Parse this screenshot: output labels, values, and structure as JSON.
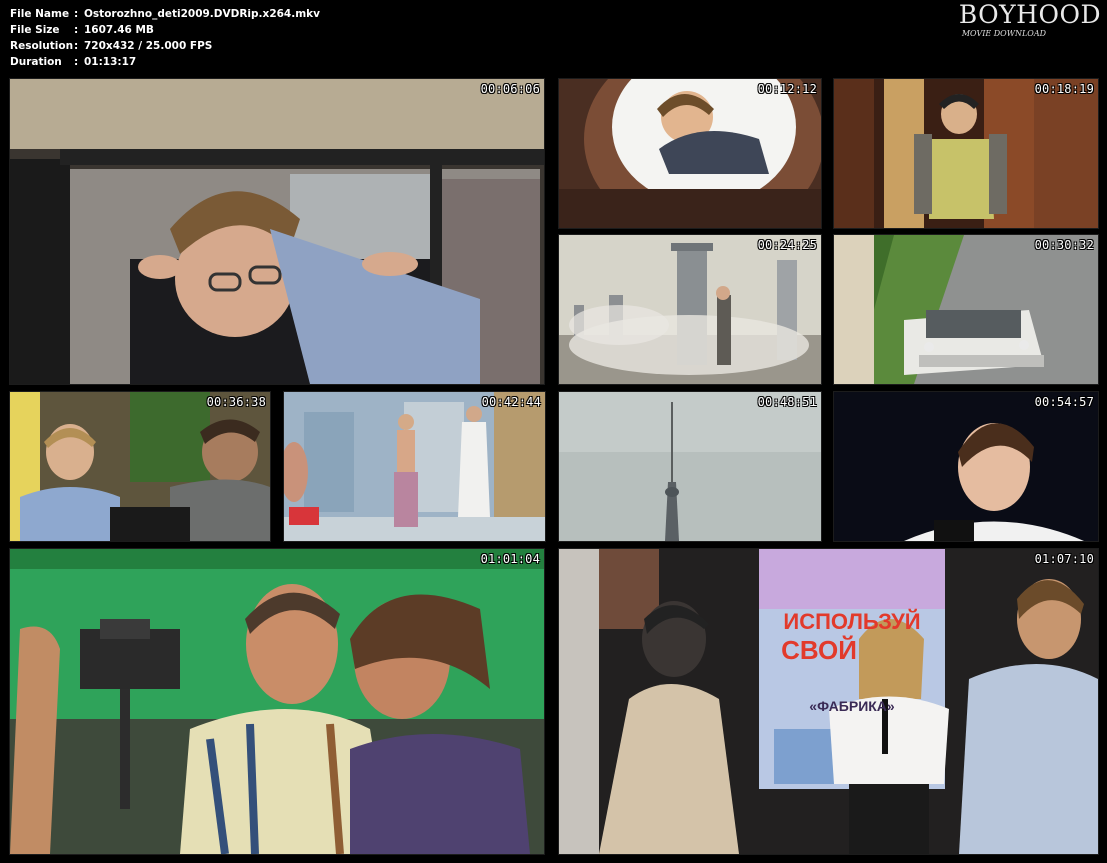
{
  "info": {
    "rows": [
      {
        "label": "File Name",
        "value": "Ostorozhno_deti2009.DVDRip.x264.mkv"
      },
      {
        "label": "File Size",
        "value": "1607.46 MB"
      },
      {
        "label": "Resolution",
        "value": "720x432 / 25.000 FPS"
      },
      {
        "label": "Duration",
        "value": "01:13:17"
      }
    ],
    "separator": ":"
  },
  "logo": {
    "main": "BOYHOOD",
    "sub": "MOVIE DOWNLOAD"
  },
  "frames": [
    {
      "timestamp": "00:06:06",
      "scene": "boy-with-glasses-in-car-window"
    },
    {
      "timestamp": "00:12:12",
      "scene": "boy-looking-into-well"
    },
    {
      "timestamp": "00:18:19",
      "scene": "boy-in-hallway"
    },
    {
      "timestamp": "00:24:25",
      "scene": "smoking-rooftop-chimneys"
    },
    {
      "timestamp": "00:30:32",
      "scene": "white-car-on-road"
    },
    {
      "timestamp": "00:36:38",
      "scene": "two-boys-talking"
    },
    {
      "timestamp": "00:42:44",
      "scene": "bathhouse-men"
    },
    {
      "timestamp": "00:48:51",
      "scene": "tv-tower"
    },
    {
      "timestamp": "00:54:57",
      "scene": "girl-portrait-dark"
    },
    {
      "timestamp": "01:01:04",
      "scene": "couple-on-film-set"
    },
    {
      "timestamp": "01:07:10",
      "scene": "girl-in-front-of-poster"
    }
  ],
  "poster": {
    "line1": "ИСПОЛЬЗУЙ",
    "line2": "СВОЙ",
    "line3": "«ФАБРИКА»"
  },
  "colors": {
    "background": "#000000",
    "text": "#ffffff",
    "green_screen": "#2fa35a"
  }
}
